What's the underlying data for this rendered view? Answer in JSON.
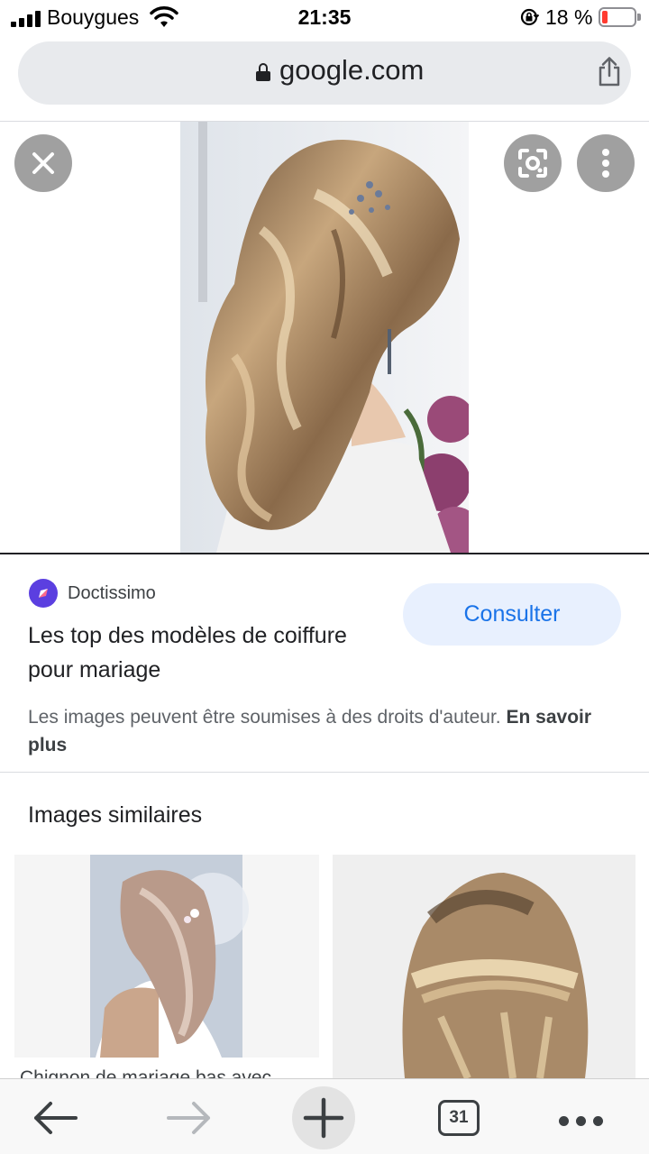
{
  "status_bar": {
    "carrier": "Bouygues",
    "time": "21:35",
    "battery_percent": "18 %",
    "battery_level": 0.18
  },
  "address_bar": {
    "url": "google.com"
  },
  "viewer": {
    "close_icon": "close-icon",
    "lens_icon": "lens-icon",
    "more_icon": "more-vert-icon"
  },
  "result": {
    "source_name": "Doctissimo",
    "title": "Les top des modèles de coiffure pour mariage",
    "action_label": "Consulter",
    "copyright_text": "Les images peuvent être soumises à des droits d'auteur.",
    "copyright_link": "En savoir plus"
  },
  "similar": {
    "heading": "Images similaires",
    "items": [
      {
        "caption": "Chignon de mariage bas avec"
      },
      {
        "caption": ""
      }
    ]
  },
  "toolbar": {
    "tab_count": "31"
  },
  "colors": {
    "accent": "#1a73e8",
    "accent_bg": "#e8f0fe",
    "battery_low": "#ff3b30",
    "source_logo": "#5b3fe0"
  }
}
